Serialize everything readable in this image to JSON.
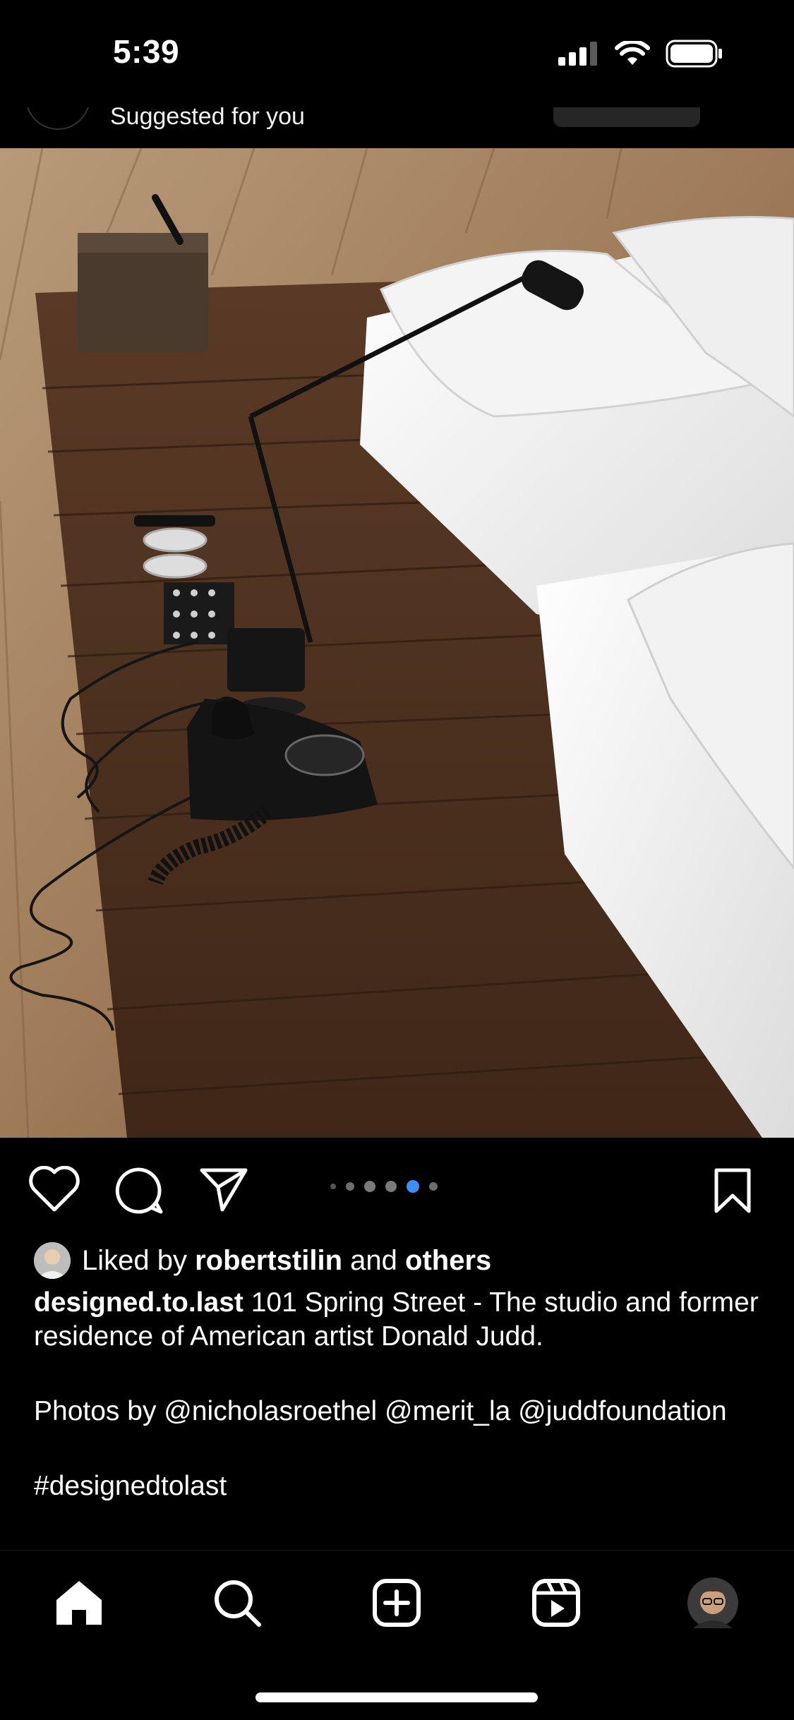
{
  "status_bar": {
    "time": "5:39"
  },
  "suggestion": {
    "text": "Suggested for you"
  },
  "carousel": {
    "count": 6,
    "active_index": 4
  },
  "post": {
    "liked_prefix": "Liked by",
    "liked_user": "robertstilin",
    "liked_and": "and",
    "liked_others": "others",
    "username": "designed.to.last",
    "caption_line1": "101 Spring Street - The studio and former residence of American artist Donald Judd.",
    "caption_line2": "Photos by @nicholasroethel @merit_la @juddfoundation",
    "hashtag": "#designedtolast"
  },
  "tabbar": {
    "items": [
      {
        "name": "home",
        "icon": "home-icon"
      },
      {
        "name": "search",
        "icon": "search-icon"
      },
      {
        "name": "create",
        "icon": "create-icon"
      },
      {
        "name": "reels",
        "icon": "reels-icon"
      },
      {
        "name": "profile",
        "icon": "profile-avatar"
      }
    ]
  },
  "colors": {
    "accent": "#3d8ff5",
    "background": "#000000",
    "text": "#ffffff"
  }
}
